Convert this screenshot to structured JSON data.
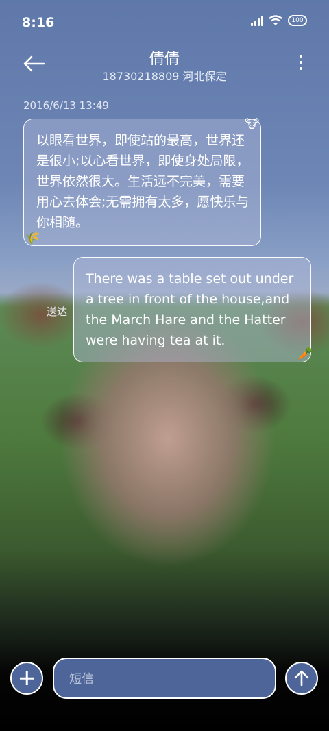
{
  "status_bar": {
    "time": "8:16",
    "battery": "100"
  },
  "header": {
    "contact_name": "倩倩",
    "contact_detail": "18730218809 河北保定"
  },
  "messages": [
    {
      "timestamp": "2016/6/13 13:49",
      "text": "以眼看世界，即使站的最高，世界还是很小;以心看世界，即使身处局限，世界依然很大。生活远不完美，需要用心去体会;无需拥有太多，愿快乐与你相随。",
      "direction": "incoming",
      "sticker_top": "🐮",
      "sticker_bottom": "🌾"
    },
    {
      "text": "There was a table set out under a tree in front of the house,and the March Hare and the Hatter were having tea at it.",
      "direction": "outgoing",
      "status": "送达",
      "sticker_bottom": "🥕"
    }
  ],
  "composer": {
    "placeholder": "短信"
  },
  "icons": {
    "back": "back-arrow-icon",
    "more": "more-vert-icon",
    "add": "plus-icon",
    "send": "send-arrow-icon"
  }
}
